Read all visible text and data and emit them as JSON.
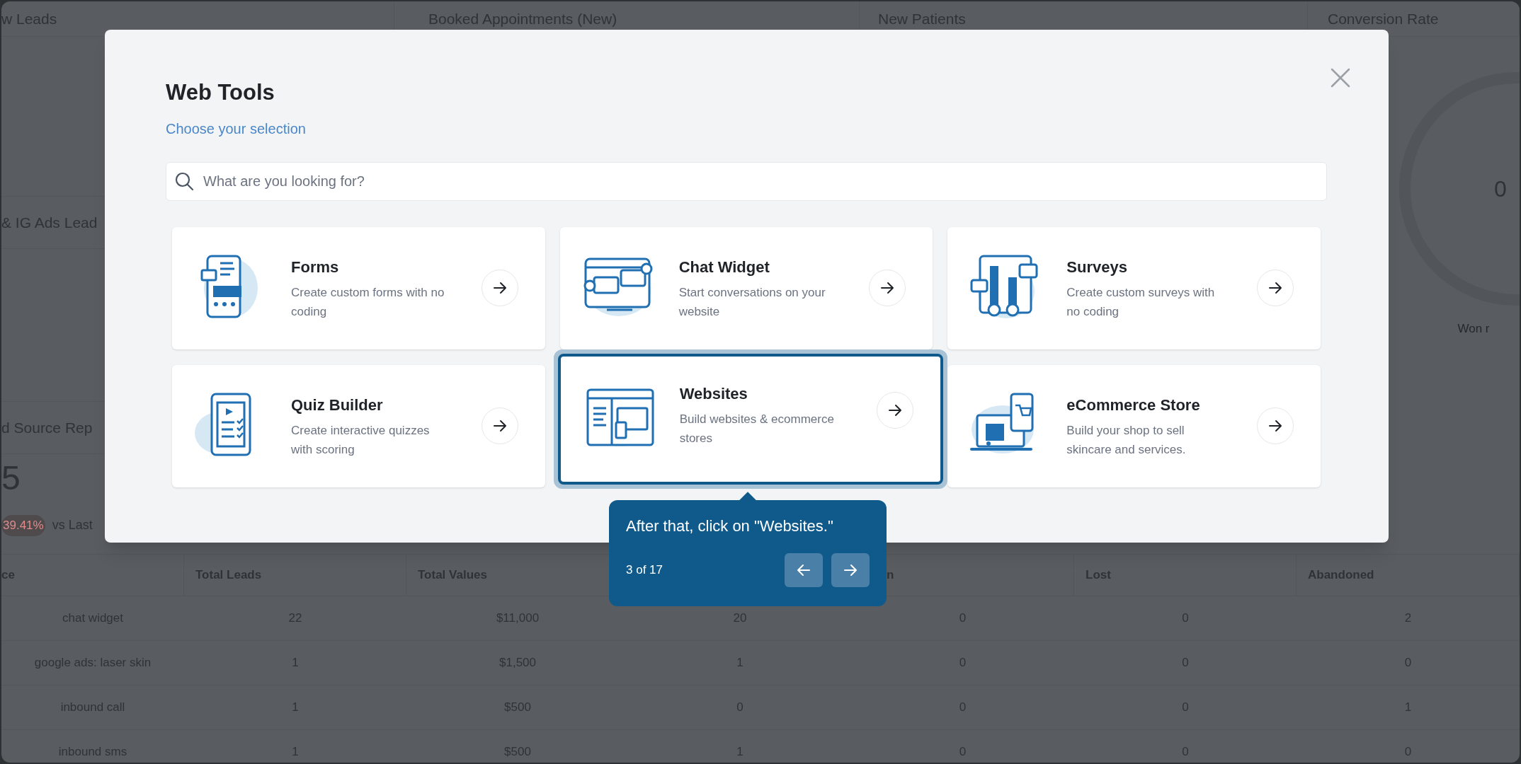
{
  "dashboard": {
    "stat_headers": [
      "w Leads",
      "Booked Appointments (New)",
      "New Patients",
      "Conversion Rate"
    ],
    "side_titles": [
      "& IG Ads Lead",
      "d Source Rep"
    ],
    "big_number": "5",
    "change_badge": "39.41%",
    "change_caption": "vs Last",
    "donut": {
      "value": "0",
      "caption": "Won r"
    },
    "table": {
      "columns": [
        "ce",
        "Total Leads",
        "Total Values",
        "",
        "n",
        "Lost",
        "Abandoned"
      ],
      "rows": [
        [
          "chat widget",
          "22",
          "$11,000",
          "20",
          "0",
          "0",
          "2"
        ],
        [
          "google ads: laser skin",
          "1",
          "$1,500",
          "1",
          "0",
          "0",
          "0"
        ],
        [
          "inbound call",
          "1",
          "$500",
          "0",
          "0",
          "0",
          "1"
        ],
        [
          "inbound sms",
          "1",
          "$500",
          "1",
          "0",
          "0",
          "0"
        ]
      ]
    }
  },
  "modal": {
    "title": "Web Tools",
    "subtitle": "Choose your selection",
    "search": {
      "placeholder": "What are you looking for?"
    },
    "cards": [
      {
        "title": "Forms",
        "description": "Create custom forms with no coding",
        "selected": false
      },
      {
        "title": "Chat Widget",
        "description": "Start conversations on your website",
        "selected": false
      },
      {
        "title": "Surveys",
        "description": "Create custom surveys with no coding",
        "selected": false
      },
      {
        "title": "Quiz Builder",
        "description": "Create interactive quizzes with scoring",
        "selected": false
      },
      {
        "title": "Websites",
        "description": "Build websites & ecommerce stores",
        "selected": true
      },
      {
        "title": "eCommerce Store",
        "description": "Build your shop to sell skincare and services.",
        "selected": false
      }
    ]
  },
  "tour_tooltip": {
    "text": "After that, click on \"Websites.\"",
    "step": "3 of 17"
  }
}
